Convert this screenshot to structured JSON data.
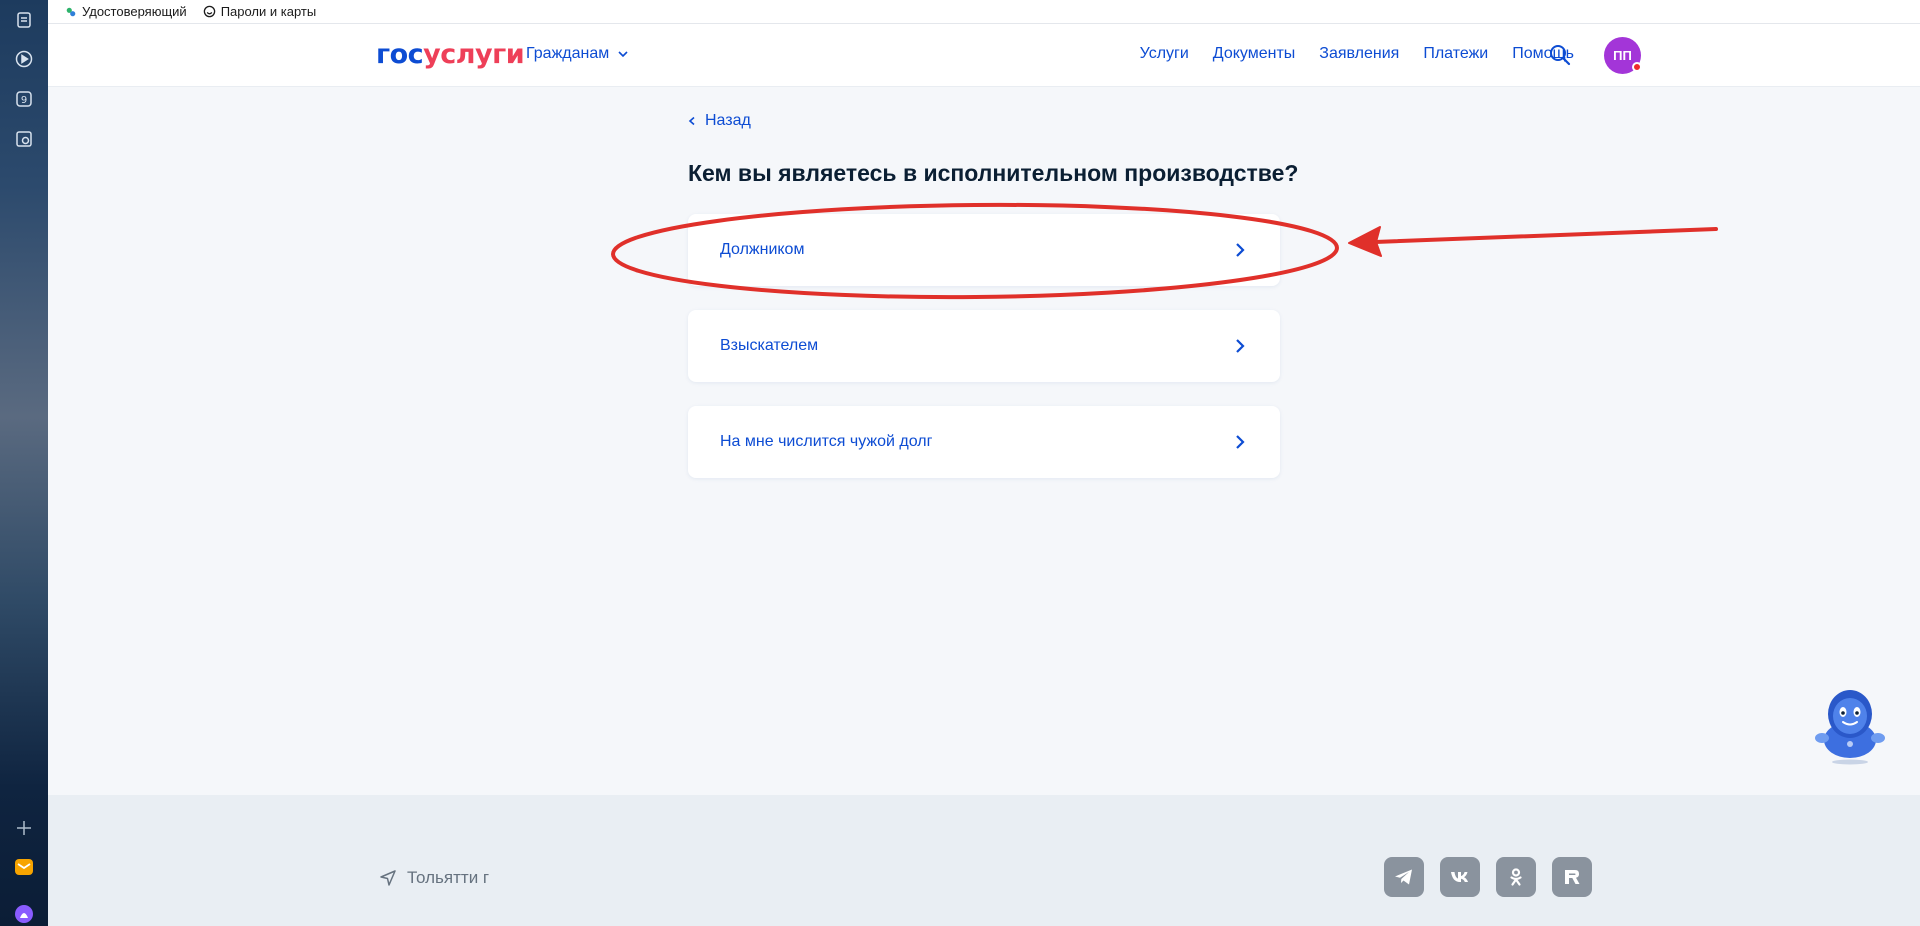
{
  "bookmarks": [
    {
      "label": "Удостоверяющий",
      "icon": "leaf-icon"
    },
    {
      "label": "Пароли и карты",
      "icon": "key-icon"
    }
  ],
  "header": {
    "logo_part1": "гос",
    "logo_part2": "услуги",
    "citizens_label": "Гражданам",
    "nav": [
      "Услуги",
      "Документы",
      "Заявления",
      "Платежи",
      "Помощь"
    ],
    "avatar_initials": "ПП"
  },
  "main": {
    "back_label": "Назад",
    "title": "Кем вы являетесь в исполнительном производстве?",
    "options": [
      {
        "label": "Должником"
      },
      {
        "label": "Взыскателем"
      },
      {
        "label": "На мне числится чужой долг"
      }
    ]
  },
  "footer": {
    "location": "Тольятти г",
    "social": [
      "telegram-icon",
      "vk-icon",
      "ok-icon",
      "rutube-icon"
    ]
  },
  "colors": {
    "brand_blue": "#0d4cd3",
    "brand_red": "#ee3f58",
    "avatar": "#a335d8",
    "annotation": "#e0302a"
  }
}
